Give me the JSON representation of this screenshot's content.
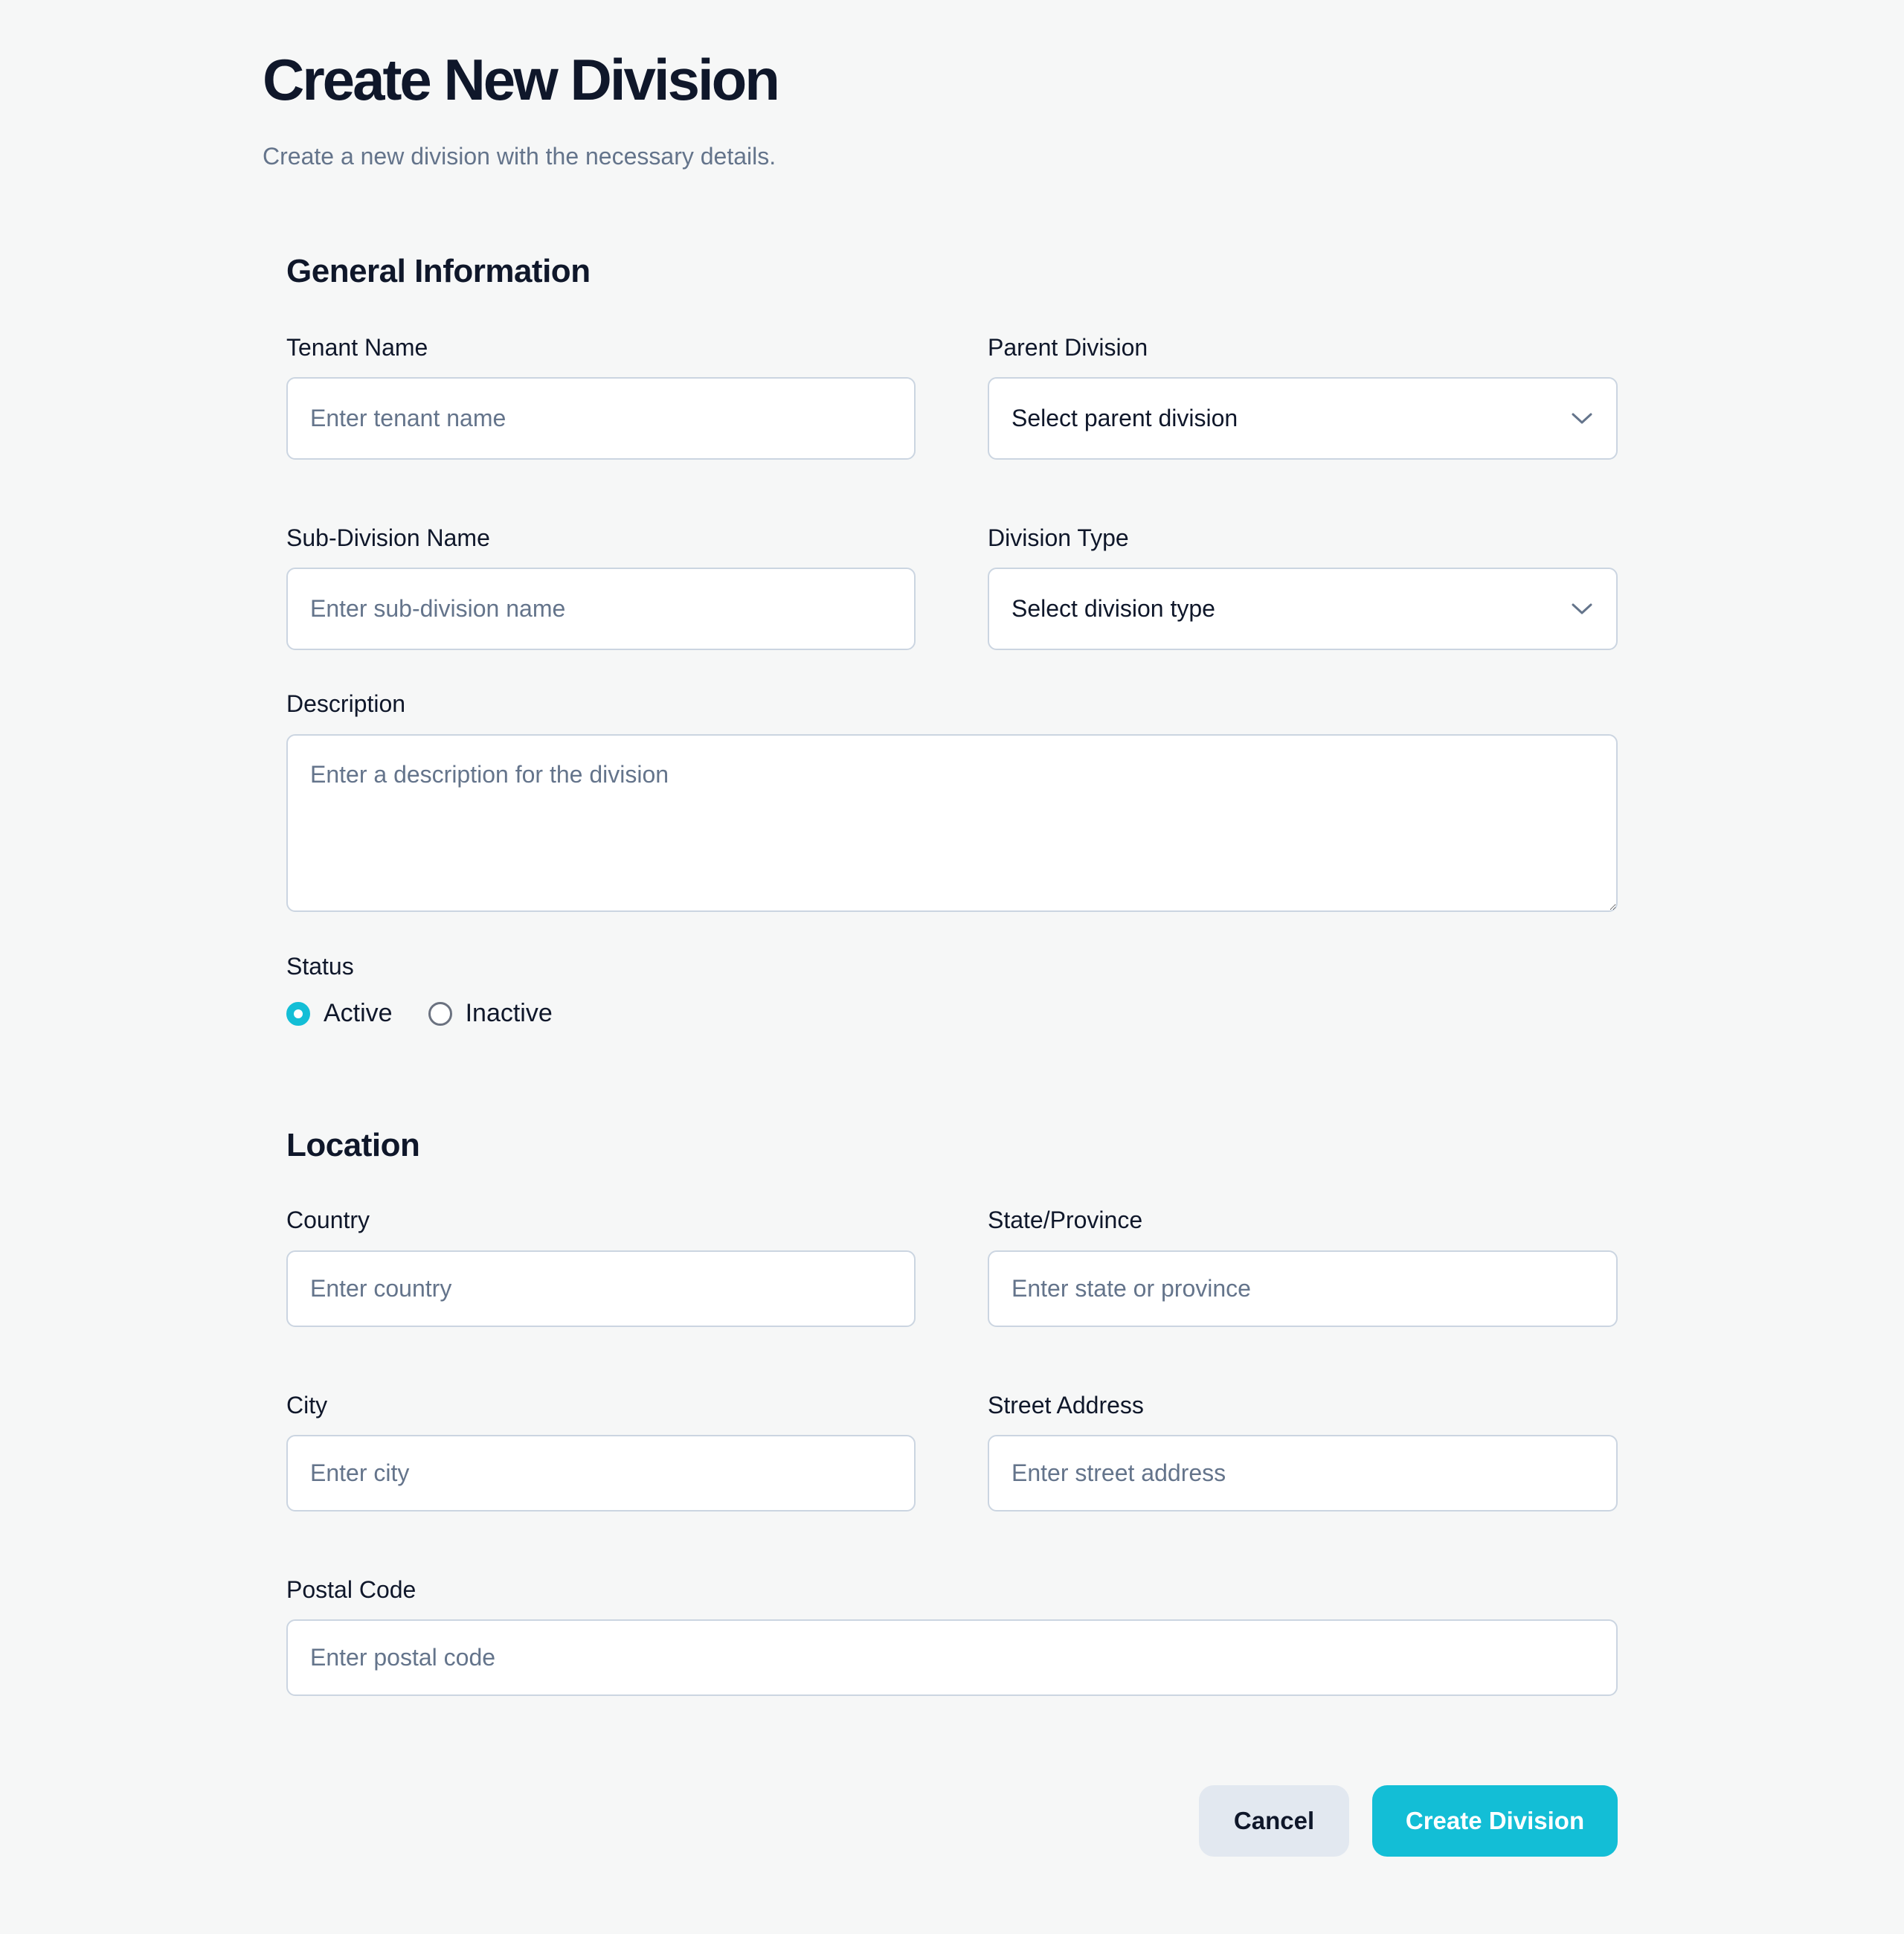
{
  "header": {
    "title": "Create New Division",
    "subtitle": "Create a new division with the necessary details."
  },
  "general": {
    "heading": "General Information",
    "tenant_name": {
      "label": "Tenant Name",
      "placeholder": "Enter tenant name"
    },
    "parent_division": {
      "label": "Parent Division",
      "value": "Select parent division",
      "icon": "chevron-down-icon"
    },
    "sub_division_name": {
      "label": "Sub-Division Name",
      "placeholder": "Enter sub-division name"
    },
    "division_type": {
      "label": "Division Type",
      "value": "Select division type",
      "icon": "chevron-down-icon"
    },
    "description": {
      "label": "Description",
      "placeholder": "Enter a description for the division"
    },
    "status": {
      "label": "Status",
      "options": [
        {
          "label": "Active",
          "selected": true
        },
        {
          "label": "Inactive",
          "selected": false
        }
      ]
    }
  },
  "location": {
    "heading": "Location",
    "country": {
      "label": "Country",
      "placeholder": "Enter country"
    },
    "state": {
      "label": "State/Province",
      "placeholder": "Enter state or province"
    },
    "city": {
      "label": "City",
      "placeholder": "Enter city"
    },
    "street": {
      "label": "Street Address",
      "placeholder": "Enter street address"
    },
    "postal": {
      "label": "Postal Code",
      "placeholder": "Enter postal code"
    }
  },
  "actions": {
    "cancel": "Cancel",
    "submit": "Create Division"
  },
  "colors": {
    "accent": "#13bed6",
    "background": "#f6f7f7",
    "cancel_bg": "#e2e8f0",
    "border": "#cbd5e1"
  }
}
